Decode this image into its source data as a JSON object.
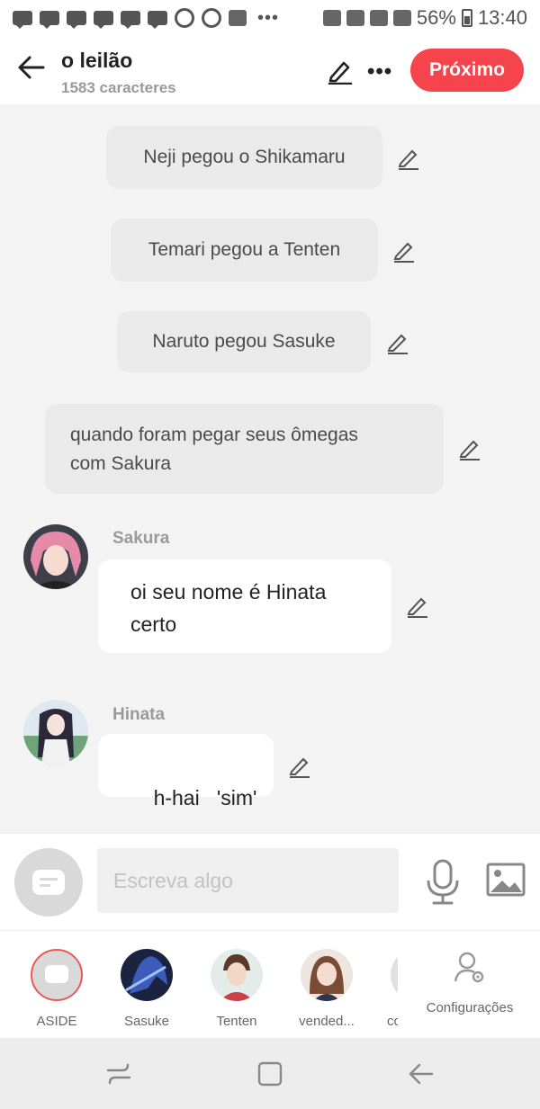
{
  "status_bar": {
    "battery": "56%",
    "time": "13:40"
  },
  "header": {
    "title": "o leilão",
    "subtitle": "1583 caracteres",
    "next_label": "Próximo"
  },
  "chat": {
    "narrations": [
      {
        "text": "Neji pegou o Shikamaru"
      },
      {
        "text": "Temari pegou a Tenten"
      },
      {
        "text": "Naruto pegou Sasuke"
      },
      {
        "text": "quando foram pegar seus ômegas com Sakura"
      }
    ],
    "messages": [
      {
        "name": "Sakura",
        "text": "oi seu nome é Hinata certo"
      },
      {
        "name": "Hinata",
        "text": "h-hai   'sim'"
      }
    ]
  },
  "input": {
    "placeholder": "Escreva algo"
  },
  "roles": [
    {
      "label": "ASIDE"
    },
    {
      "label": "Sasuke"
    },
    {
      "label": "Tenten"
    },
    {
      "label": "vended..."
    },
    {
      "label": "cc"
    }
  ],
  "settings_label": "Configurações",
  "colors": {
    "accent": "#f5444b",
    "background": "#f3f3f3",
    "bubble": "#ffffff",
    "narration": "#eaeaea"
  }
}
